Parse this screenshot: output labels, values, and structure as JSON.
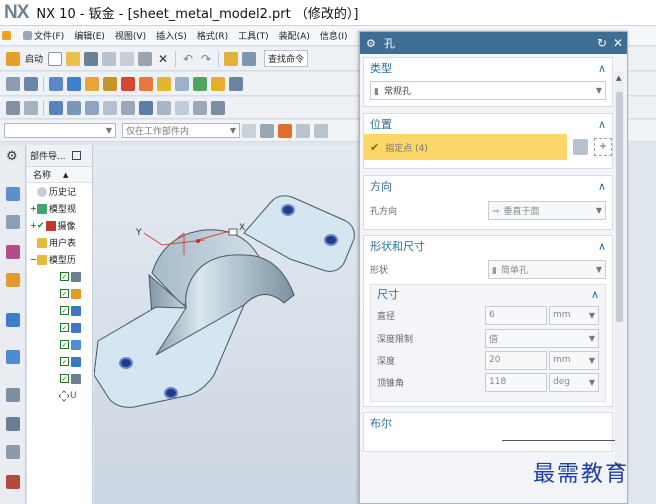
{
  "window": {
    "logo": "NX",
    "title": "NX 10 - 钣金 - [sheet_metal_model2.prt （修改的）]"
  },
  "menubar": {
    "items": [
      "文件(F)",
      "编辑(E)",
      "视图(V)",
      "插入(S)",
      "格式(R)",
      "工具(T)",
      "装配(A)",
      "信息(I)"
    ]
  },
  "toolbar": {
    "start_label": "启动",
    "search_label": "查找命令",
    "selection_scope": "仅在工作部件内"
  },
  "navigator": {
    "title": "部件导...",
    "column_name": "名称",
    "rows": [
      {
        "label": "历史记"
      },
      {
        "label": "模型视"
      },
      {
        "label": "摄像"
      },
      {
        "label": "用户表"
      },
      {
        "label": "模型历"
      }
    ]
  },
  "dialog": {
    "title": "孔",
    "type": {
      "header": "类型",
      "value": "常规孔"
    },
    "position": {
      "header": "位置",
      "specify_point": "指定点 (4)"
    },
    "direction": {
      "header": "方向",
      "hole_direction_label": "孔方向",
      "hole_direction_value": "垂直于面"
    },
    "form": {
      "header": "形状和尺寸",
      "shape_label": "形状",
      "shape_value": "简单孔",
      "dimensions": {
        "header": "尺寸",
        "diameter_label": "直径",
        "diameter_value": "6",
        "diameter_unit": "mm",
        "depth_limit_label": "深度限制",
        "depth_limit_value": "值",
        "depth_label": "深度",
        "depth_value": "20",
        "depth_unit": "mm",
        "tip_angle_label": "顶锥角",
        "tip_angle_value": "118",
        "tip_angle_unit": "deg"
      }
    },
    "boolean": {
      "header": "布尔"
    }
  },
  "graphics": {
    "axis_x": "X",
    "axis_y": "Y"
  },
  "watermark": "最需教育"
}
